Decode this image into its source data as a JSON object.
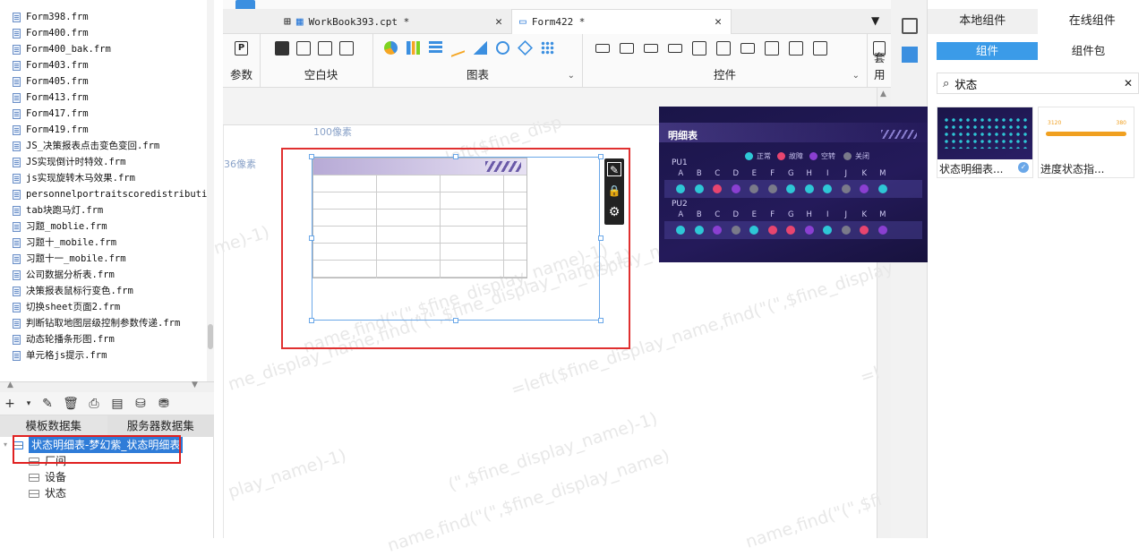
{
  "file_list": {
    "items": [
      "Form398.frm",
      "Form400.frm",
      "Form400_bak.frm",
      "Form403.frm",
      "Form405.frm",
      "Form413.frm",
      "Form417.frm",
      "Form419.frm",
      "JS_决策报表点击变色变回.frm",
      "JS实现倒计时特效.frm",
      "js实现旋转木马效果.frm",
      "personnelportraitscoredistributio",
      "tab块跑马灯.frm",
      "习题_moblie.frm",
      "习题十_mobile.frm",
      "习题十一_mobile.frm",
      "公司数据分析表.frm",
      "决策报表鼠标行变色.frm",
      "切换sheet页面2.frm",
      "判断钻取地图层级控制参数传递.frm",
      "动态轮播条形图.frm",
      "单元格js提示.frm"
    ]
  },
  "dataset_tabs": [
    "模板数据集",
    "服务器数据集"
  ],
  "dataset_tree": {
    "root": "状态明细表-梦幻紫_状态明细表",
    "fields": [
      "厂间",
      "设备",
      "状态"
    ]
  },
  "doc_tabs": [
    {
      "label": "WorkBook393.cpt *"
    },
    {
      "label": "Form422 *"
    }
  ],
  "ribbon": {
    "groups": [
      "参数",
      "空白块",
      "图表",
      "控件",
      "套用"
    ]
  },
  "canvas": {
    "ruler_x": "100像素",
    "ruler_y": "36像素",
    "watermarks": [
      "=left($fine_disp",
      "me)-1)",
      "name,find(\"(\",$fine_display_name)-1)",
      "_display_name,find(\"(\",$fine_di",
      "me_display_name,find(\"(\",$fine_display_name)-1)",
      "=left($fine_display_name,find(\"(\",$fine_display_name)-1)",
      "=l",
      "play_name)-1)",
      "(\",$fine_display_name)-1)",
      "name,find(\"(\",$fine_display_name)",
      "name,find(\"(\",$fi"
    ]
  },
  "right_panel": {
    "tabs": [
      "本地组件",
      "在线组件"
    ],
    "subtabs": [
      "组件",
      "组件包"
    ],
    "search_value": "状态",
    "cards": [
      {
        "label": "状态明细表..."
      },
      {
        "label": "进度状态指..."
      }
    ],
    "progress_card": {
      "left_value": "3120",
      "right_value": "380"
    }
  },
  "preview": {
    "title": "明细表",
    "legend": [
      {
        "label": "正常",
        "color": "#2ec7d6"
      },
      {
        "label": "故障",
        "color": "#e8456f"
      },
      {
        "label": "空转",
        "color": "#8a3fd1"
      },
      {
        "label": "关闭",
        "color": "#7a7a8a"
      }
    ],
    "groups": [
      {
        "name": "PU1",
        "cols": [
          "A",
          "B",
          "C",
          "D",
          "E",
          "F",
          "G",
          "H",
          "I",
          "J",
          "K",
          "M"
        ],
        "colors": [
          "#2ec7d6",
          "#2ec7d6",
          "#e8456f",
          "#8a3fd1",
          "#7a7a8a",
          "#7a7a8a",
          "#2ec7d6",
          "#2ec7d6",
          "#2ec7d6",
          "#7a7a8a",
          "#8a3fd1",
          "#2ec7d6"
        ]
      },
      {
        "name": "PU2",
        "cols": [
          "A",
          "B",
          "C",
          "D",
          "E",
          "F",
          "G",
          "H",
          "I",
          "J",
          "K",
          "M"
        ],
        "colors": [
          "#2ec7d6",
          "#2ec7d6",
          "#8a3fd1",
          "#7a7a8a",
          "#2ec7d6",
          "#e8456f",
          "#e8456f",
          "#8a3fd1",
          "#2ec7d6",
          "#7a7a8a",
          "#e8456f",
          "#8a3fd1"
        ]
      }
    ]
  }
}
